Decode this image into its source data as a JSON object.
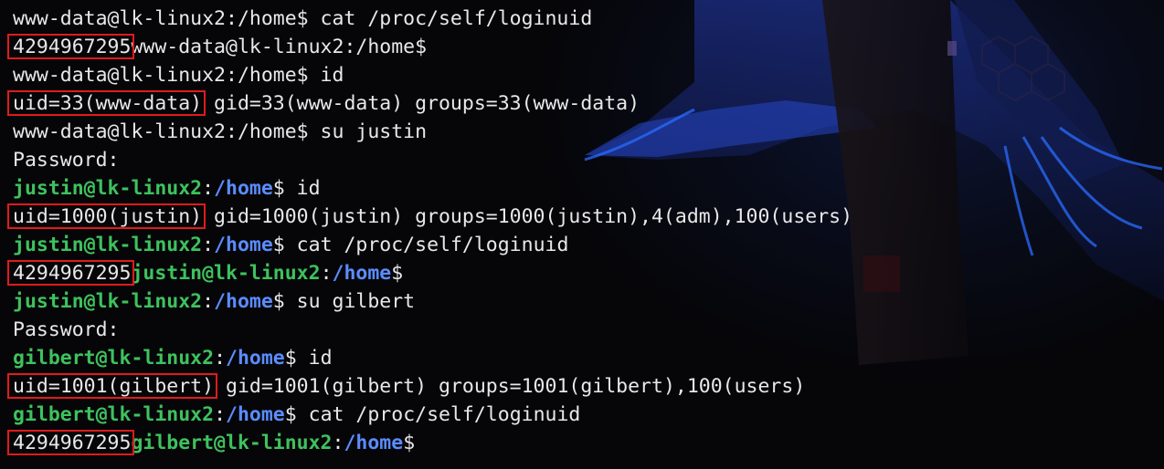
{
  "terminal": {
    "lines": [
      [
        {
          "t": "www-data@lk-linux2:/home$ cat /proc/self/loginuid",
          "c": "default"
        }
      ],
      [
        {
          "t": "4294967295",
          "c": "default"
        },
        {
          "t": "www-data@lk-linux2:/home$",
          "c": "default"
        }
      ],
      [
        {
          "t": "www-data@lk-linux2:/home$ id",
          "c": "default"
        }
      ],
      [
        {
          "t": "uid=33(www-data)",
          "c": "default"
        },
        {
          "t": " gid=33(www-data) groups=33(www-data)",
          "c": "default"
        }
      ],
      [
        {
          "t": "www-data@lk-linux2:/home$ su justin",
          "c": "default"
        }
      ],
      [
        {
          "t": "Password:",
          "c": "default"
        }
      ],
      [
        {
          "t": "justin@lk-linux2",
          "c": "user"
        },
        {
          "t": ":",
          "c": "sep"
        },
        {
          "t": "/home",
          "c": "path"
        },
        {
          "t": "$ id",
          "c": "prompt"
        }
      ],
      [
        {
          "t": "uid=1000(justin)",
          "c": "default"
        },
        {
          "t": " gid=1000(justin) groups=1000(justin),4(adm),100(users)",
          "c": "default"
        }
      ],
      [
        {
          "t": "justin@lk-linux2",
          "c": "user"
        },
        {
          "t": ":",
          "c": "sep"
        },
        {
          "t": "/home",
          "c": "path"
        },
        {
          "t": "$ cat /proc/self/loginuid",
          "c": "prompt"
        }
      ],
      [
        {
          "t": "4294967295",
          "c": "default"
        },
        {
          "t": "justin@lk-linux2",
          "c": "user"
        },
        {
          "t": ":",
          "c": "sep"
        },
        {
          "t": "/home",
          "c": "path"
        },
        {
          "t": "$",
          "c": "prompt"
        }
      ],
      [
        {
          "t": "justin@lk-linux2",
          "c": "user"
        },
        {
          "t": ":",
          "c": "sep"
        },
        {
          "t": "/home",
          "c": "path"
        },
        {
          "t": "$ su gilbert",
          "c": "prompt"
        }
      ],
      [
        {
          "t": "Password:",
          "c": "default"
        }
      ],
      [
        {
          "t": "gilbert@lk-linux2",
          "c": "user"
        },
        {
          "t": ":",
          "c": "sep"
        },
        {
          "t": "/home",
          "c": "path"
        },
        {
          "t": "$ id",
          "c": "prompt"
        }
      ],
      [
        {
          "t": "uid=1001(gilbert)",
          "c": "default"
        },
        {
          "t": " gid=1001(gilbert) groups=1001(gilbert),100(users)",
          "c": "default"
        }
      ],
      [
        {
          "t": "gilbert@lk-linux2",
          "c": "user"
        },
        {
          "t": ":",
          "c": "sep"
        },
        {
          "t": "/home",
          "c": "path"
        },
        {
          "t": "$ cat /proc/self/loginuid",
          "c": "prompt"
        }
      ],
      [
        {
          "t": "4294967295",
          "c": "default"
        },
        {
          "t": "gilbert@lk-linux2",
          "c": "user"
        },
        {
          "t": ":",
          "c": "sep"
        },
        {
          "t": "/home",
          "c": "path"
        },
        {
          "t": "$",
          "c": "prompt"
        }
      ]
    ],
    "highlights": [
      {
        "line": 1,
        "seg": 0
      },
      {
        "line": 3,
        "seg": 0
      },
      {
        "line": 7,
        "seg": 0
      },
      {
        "line": 9,
        "seg": 0
      },
      {
        "line": 13,
        "seg": 0
      },
      {
        "line": 15,
        "seg": 0
      }
    ],
    "colors": {
      "text": "#e8e8e8",
      "user": "#3ec25d",
      "path": "#5b8cff",
      "highlight_box": "#e01b1b",
      "background": "#07070a"
    }
  }
}
